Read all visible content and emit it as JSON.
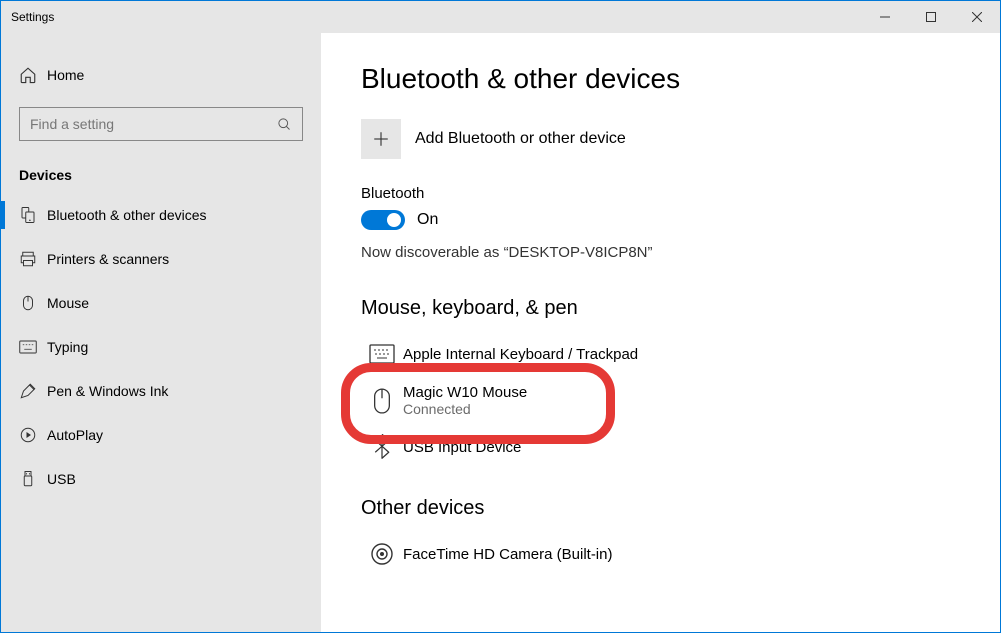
{
  "window": {
    "title": "Settings"
  },
  "sidebar": {
    "home_label": "Home",
    "search_placeholder": "Find a setting",
    "heading": "Devices",
    "items": [
      {
        "label": "Bluetooth & other devices",
        "icon": "bluetooth-devices",
        "selected": true
      },
      {
        "label": "Printers & scanners",
        "icon": "printer",
        "selected": false
      },
      {
        "label": "Mouse",
        "icon": "mouse",
        "selected": false
      },
      {
        "label": "Typing",
        "icon": "keyboard",
        "selected": false
      },
      {
        "label": "Pen & Windows Ink",
        "icon": "pen",
        "selected": false
      },
      {
        "label": "AutoPlay",
        "icon": "autoplay",
        "selected": false
      },
      {
        "label": "USB",
        "icon": "usb",
        "selected": false
      }
    ]
  },
  "content": {
    "title": "Bluetooth & other devices",
    "add_label": "Add Bluetooth or other device",
    "bt_heading": "Bluetooth",
    "bt_state_label": "On",
    "discoverable": "Now discoverable as “DESKTOP-V8ICP8N”",
    "section_mouse": "Mouse, keyboard, & pen",
    "devices_mouse": [
      {
        "name": "Apple Internal Keyboard / Trackpad",
        "status": "",
        "icon": "keyboard"
      },
      {
        "name": "Magic W10 Mouse",
        "status": "Connected",
        "icon": "mouse",
        "highlight": true
      },
      {
        "name": "USB Input Device",
        "status": "",
        "icon": "bluetooth"
      }
    ],
    "section_other": "Other devices",
    "devices_other": [
      {
        "name": "FaceTime HD Camera (Built-in)",
        "status": "",
        "icon": "camera"
      }
    ]
  }
}
